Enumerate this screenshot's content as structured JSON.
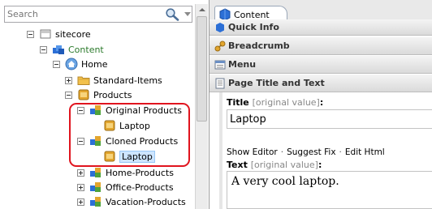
{
  "search": {
    "placeholder": "Search"
  },
  "tree": {
    "sitecore": "sitecore",
    "content": "Content",
    "home": "Home",
    "standard_items": "Standard-Items",
    "products": "Products",
    "original_products": "Original Products",
    "laptop_original": "Laptop",
    "cloned_products": "Cloned Products",
    "laptop_cloned": "Laptop",
    "home_products": "Home-Products",
    "office_products": "Office-Products",
    "vacation_products": "Vacation-Products"
  },
  "tab": {
    "label": "Content"
  },
  "sections": {
    "quick_info": "Quick Info",
    "breadcrumb": "Breadcrumb",
    "menu": "Menu",
    "page_title_text": "Page Title and Text"
  },
  "fields": {
    "title_label": "Title",
    "title_hint": "[original value]",
    "title_value": "Laptop",
    "show_editor": "Show Editor",
    "suggest_fix": "Suggest Fix",
    "edit_html": "Edit Html",
    "text_label": "Text",
    "text_hint": "[original value]",
    "text_value": "A very cool laptop.",
    "colon": ":",
    "bullet": "·"
  },
  "colors": {
    "highlight": "#e0141e",
    "selection": "#cde5ff",
    "content_node": "#2b7a2b"
  }
}
